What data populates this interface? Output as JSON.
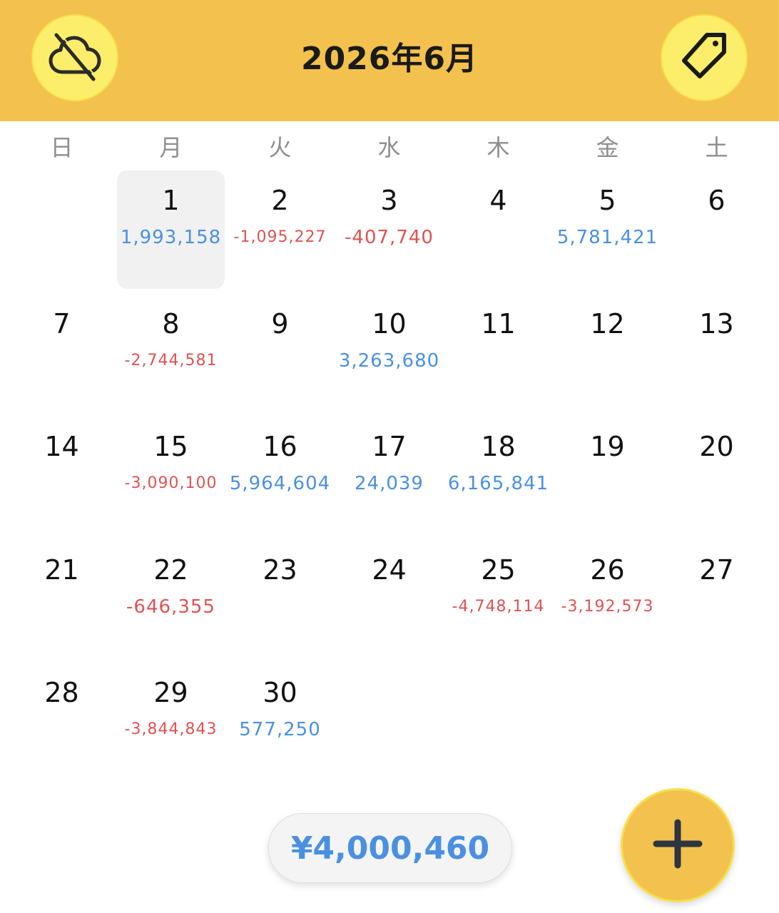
{
  "header": {
    "title": "2026年6月",
    "cloud_icon": "cloud-off-icon",
    "tag_icon": "tag-icon"
  },
  "weekdays": [
    "日",
    "月",
    "火",
    "水",
    "木",
    "金",
    "土"
  ],
  "calendar": {
    "selected_day": 1,
    "cells": [
      {
        "day": "",
        "amount": "",
        "sign": ""
      },
      {
        "day": "1",
        "amount": "1,993,158",
        "sign": "pos"
      },
      {
        "day": "2",
        "amount": "-1,095,227",
        "sign": "neg"
      },
      {
        "day": "3",
        "amount": "-407,740",
        "sign": "neg"
      },
      {
        "day": "4",
        "amount": "",
        "sign": ""
      },
      {
        "day": "5",
        "amount": "5,781,421",
        "sign": "pos"
      },
      {
        "day": "6",
        "amount": "",
        "sign": ""
      },
      {
        "day": "7",
        "amount": "",
        "sign": ""
      },
      {
        "day": "8",
        "amount": "-2,744,581",
        "sign": "neg"
      },
      {
        "day": "9",
        "amount": "",
        "sign": ""
      },
      {
        "day": "10",
        "amount": "3,263,680",
        "sign": "pos"
      },
      {
        "day": "11",
        "amount": "",
        "sign": ""
      },
      {
        "day": "12",
        "amount": "",
        "sign": ""
      },
      {
        "day": "13",
        "amount": "",
        "sign": ""
      },
      {
        "day": "14",
        "amount": "",
        "sign": ""
      },
      {
        "day": "15",
        "amount": "-3,090,100",
        "sign": "neg"
      },
      {
        "day": "16",
        "amount": "5,964,604",
        "sign": "pos"
      },
      {
        "day": "17",
        "amount": "24,039",
        "sign": "pos"
      },
      {
        "day": "18",
        "amount": "6,165,841",
        "sign": "pos"
      },
      {
        "day": "19",
        "amount": "",
        "sign": ""
      },
      {
        "day": "20",
        "amount": "",
        "sign": ""
      },
      {
        "day": "21",
        "amount": "",
        "sign": ""
      },
      {
        "day": "22",
        "amount": "-646,355",
        "sign": "neg"
      },
      {
        "day": "23",
        "amount": "",
        "sign": ""
      },
      {
        "day": "24",
        "amount": "",
        "sign": ""
      },
      {
        "day": "25",
        "amount": "-4,748,114",
        "sign": "neg"
      },
      {
        "day": "26",
        "amount": "-3,192,573",
        "sign": "neg"
      },
      {
        "day": "27",
        "amount": "",
        "sign": ""
      },
      {
        "day": "28",
        "amount": "",
        "sign": ""
      },
      {
        "day": "29",
        "amount": "-3,844,843",
        "sign": "neg"
      },
      {
        "day": "30",
        "amount": "577,250",
        "sign": "pos"
      }
    ]
  },
  "footer": {
    "total": "¥4,000,460",
    "add_icon": "plus-icon"
  },
  "colors": {
    "header_bg": "#f3c14d",
    "button_bg": "#fcee6a",
    "positive": "#4a90e2",
    "negative": "#e05252"
  }
}
